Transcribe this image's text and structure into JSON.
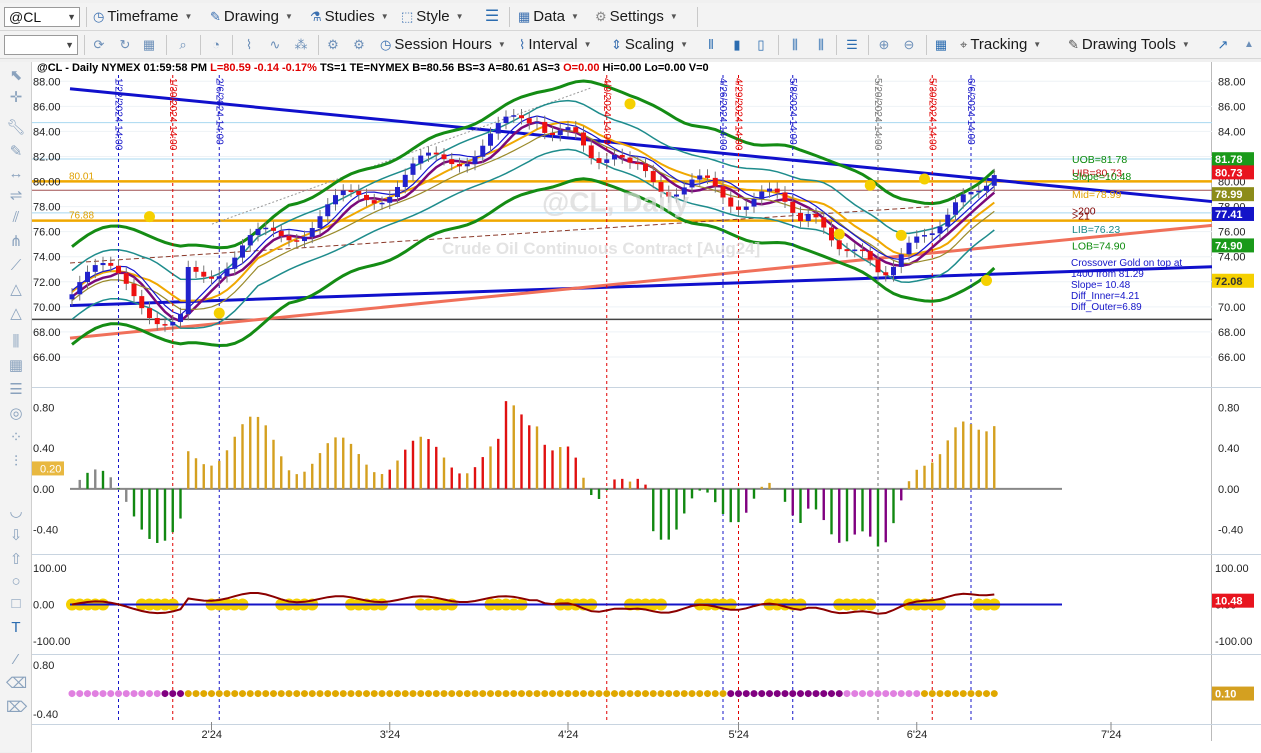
{
  "toolbar": {
    "symbol": "@CL",
    "timeframe": "Timeframe",
    "drawing": "Drawing",
    "studies": "Studies",
    "style": "Style",
    "data": "Data",
    "settings": "Settings",
    "session_hours": "Session Hours",
    "interval": "Interval",
    "scaling": "Scaling",
    "tracking": "Tracking",
    "drawing_tools": "Drawing Tools"
  },
  "chart": {
    "header": [
      {
        "text": "@CL - Daily  NYMEX  01:59:58 PM",
        "color": "#000000"
      },
      {
        "text": "L=80.59",
        "color": "#e00000"
      },
      {
        "text": "-0.14",
        "color": "#e00000"
      },
      {
        "text": "-0.17%",
        "color": "#e00000"
      },
      {
        "text": "TS=1  TE=NYMEX  B=80.56  BS=3  A=80.61  AS=3",
        "color": "#000000"
      },
      {
        "text": "O=0.00",
        "color": "#e00000"
      },
      {
        "text": "Hi=0.00  Lo=0.00  V=0",
        "color": "#000000"
      }
    ],
    "watermark_symbol": "@CL, Daily",
    "watermark_name": "Crude Oil Continuous Contract [Aug24]",
    "left_level_labels": [
      {
        "text": "80.01",
        "price": 80.01,
        "color": "#e0a000"
      },
      {
        "text": "76.88",
        "price": 76.88,
        "color": "#e0a000"
      }
    ],
    "price_axis": {
      "ticks": [
        "88.00",
        "86.00",
        "84.00",
        "82.00",
        "80.00",
        "78.00",
        "76.00",
        "74.00",
        "72.00",
        "70.00",
        "68.00",
        "66.00"
      ],
      "min": 64.0,
      "max": 88.5,
      "badges": [
        {
          "text": "81.78",
          "price": 81.78,
          "bg": "#1a9a1a",
          "fg": "#ffffff"
        },
        {
          "text": "80.73",
          "price": 80.73,
          "bg": "#e8141e",
          "fg": "#ffffff"
        },
        {
          "text": "78.99",
          "price": 78.99,
          "bg": "#8c8c1a",
          "fg": "#ffffff"
        },
        {
          "text": "77.41",
          "price": 77.41,
          "bg": "#1414c8",
          "fg": "#ffffff"
        },
        {
          "text": "74.90",
          "price": 74.9,
          "bg": "#1a9a1a",
          "fg": "#ffffff"
        },
        {
          "text": "72.08",
          "price": 72.08,
          "bg": "#f5d000",
          "fg": "#333333"
        }
      ]
    },
    "band_labels": [
      {
        "text": "UOB=81.78",
        "price": 81.78,
        "color": "#0a8a0a"
      },
      {
        "text": "UIB=80.73",
        "price": 80.73,
        "color": "#c01010"
      },
      {
        "text": "Slope=10.48",
        "price": 80.45,
        "color": "#0a8a0a"
      },
      {
        "text": "Mid=78.99",
        "price": 78.99,
        "color": "#e0a000"
      },
      {
        "text": ">200",
        "price": 77.7,
        "color": "#800000"
      },
      {
        "text": ">21",
        "price": 77.3,
        "color": "#800000"
      },
      {
        "text": "LIB=76.23",
        "price": 76.23,
        "color": "#1a8a8a"
      },
      {
        "text": "LOB=74.90",
        "price": 74.9,
        "color": "#0a8a0a"
      }
    ],
    "info_text": [
      "Crossover Gold on top at",
      "1400 from 81.29",
      "Slope= 10.48",
      "Diff_Inner=4.21",
      "Diff_Outer=6.89"
    ],
    "vertical_markers": [
      {
        "text": "1/22/2024 14:00",
        "color": "#1414c8"
      },
      {
        "text": "1/30/2024 14:00",
        "color": "#e00000"
      },
      {
        "text": "2/6/2024 14:00",
        "color": "#1414c8"
      },
      {
        "text": "4/9/2024 14:00",
        "color": "#e00000"
      },
      {
        "text": "4/26/2024 14:00",
        "color": "#1414c8"
      },
      {
        "text": "4/29/2024 14:00",
        "color": "#e00000"
      },
      {
        "text": "5/8/2024 14:00",
        "color": "#1414c8"
      },
      {
        "text": "5/20/2024 14:00",
        "color": "#777777"
      },
      {
        "text": "5/30/2024 14:00",
        "color": "#e00000"
      },
      {
        "text": "6/6/2024 14:00",
        "color": "#1414c8"
      }
    ],
    "x_axis": [
      "2'24",
      "3'24",
      "4'24",
      "5'24",
      "6'24",
      "7'24"
    ]
  },
  "panes": {
    "histogram": {
      "ticks": [
        "0.80",
        "0.40",
        "0.00",
        "-0.40"
      ],
      "badge": "0.20"
    },
    "slope": {
      "ticks": [
        "100.00",
        "0.00",
        "-100.00"
      ],
      "badge": "10.48"
    },
    "dots": {
      "ticks": [
        "0.80",
        "-0.40"
      ],
      "badge": "0.10"
    }
  },
  "colors": {
    "bull": "#2222cc",
    "bear": "#ee1111",
    "outer_band": "#148c14",
    "inner_band": "#1e8c8c",
    "gold": "#f0a800",
    "purple": "#7a0a7a",
    "trend_blue": "#1010cc",
    "trend_salmon": "#f0705a"
  },
  "icons": {
    "sidebar": [
      "cursor-icon",
      "crosshair-icon",
      "wrench-icon",
      "pencil-icon",
      "move-icon",
      "horizontal-line-icon",
      "parallel-lines-icon",
      "pitchfork-icon",
      "triangle-icon",
      "triangle-outline-icon",
      "triangle-small-icon",
      "bars-icon",
      "gann-icon",
      "fib-icon",
      "circle-target-icon",
      "dots-icon",
      "cycle-icon",
      "arc-icon",
      "arrow-down-icon",
      "arrow-up-icon",
      "ellipse-icon",
      "rectangle-icon",
      "text-icon",
      "magic-icon",
      "eraser-icon",
      "delete-icon"
    ]
  }
}
